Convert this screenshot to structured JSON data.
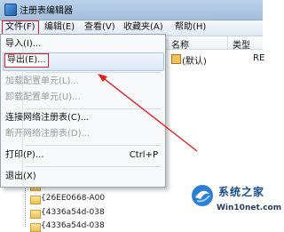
{
  "window": {
    "title": "注册表编辑器"
  },
  "menubar": [
    "文件(F)",
    "编辑(E)",
    "查看(V)",
    "收藏夹(A)",
    "帮助(H)"
  ],
  "list": {
    "col_name": "名称",
    "col_type": "类型",
    "row1_name": "(默认)",
    "row1_type": "RE"
  },
  "dropdown": {
    "items": [
      {
        "label": "导入(I)...",
        "disabled": false
      },
      {
        "label": "导出(E)...",
        "disabled": false,
        "highlighted": true
      },
      {
        "label": "加载配置单元(L)...",
        "disabled": true
      },
      {
        "label": "卸载配置单元(U)...",
        "disabled": true
      },
      {
        "label": "连接网络注册表(C)...",
        "disabled": false
      },
      {
        "label": "断开网络注册表(D)...",
        "disabled": true
      },
      {
        "label": "打印(P)...",
        "disabled": false,
        "shortcut": "Ctrl+P"
      },
      {
        "label": "退出(X)",
        "disabled": false
      }
    ]
  },
  "tree": [
    "{1818102-E9C",
    "{26EE0668-A00",
    "{4336a54d-038",
    "{4336a54d-038"
  ],
  "watermark": {
    "brand": "系统之家",
    "site": "Win10net.com"
  },
  "colors": {
    "highlight_border": "#e02020",
    "arrow": "#e02020"
  }
}
